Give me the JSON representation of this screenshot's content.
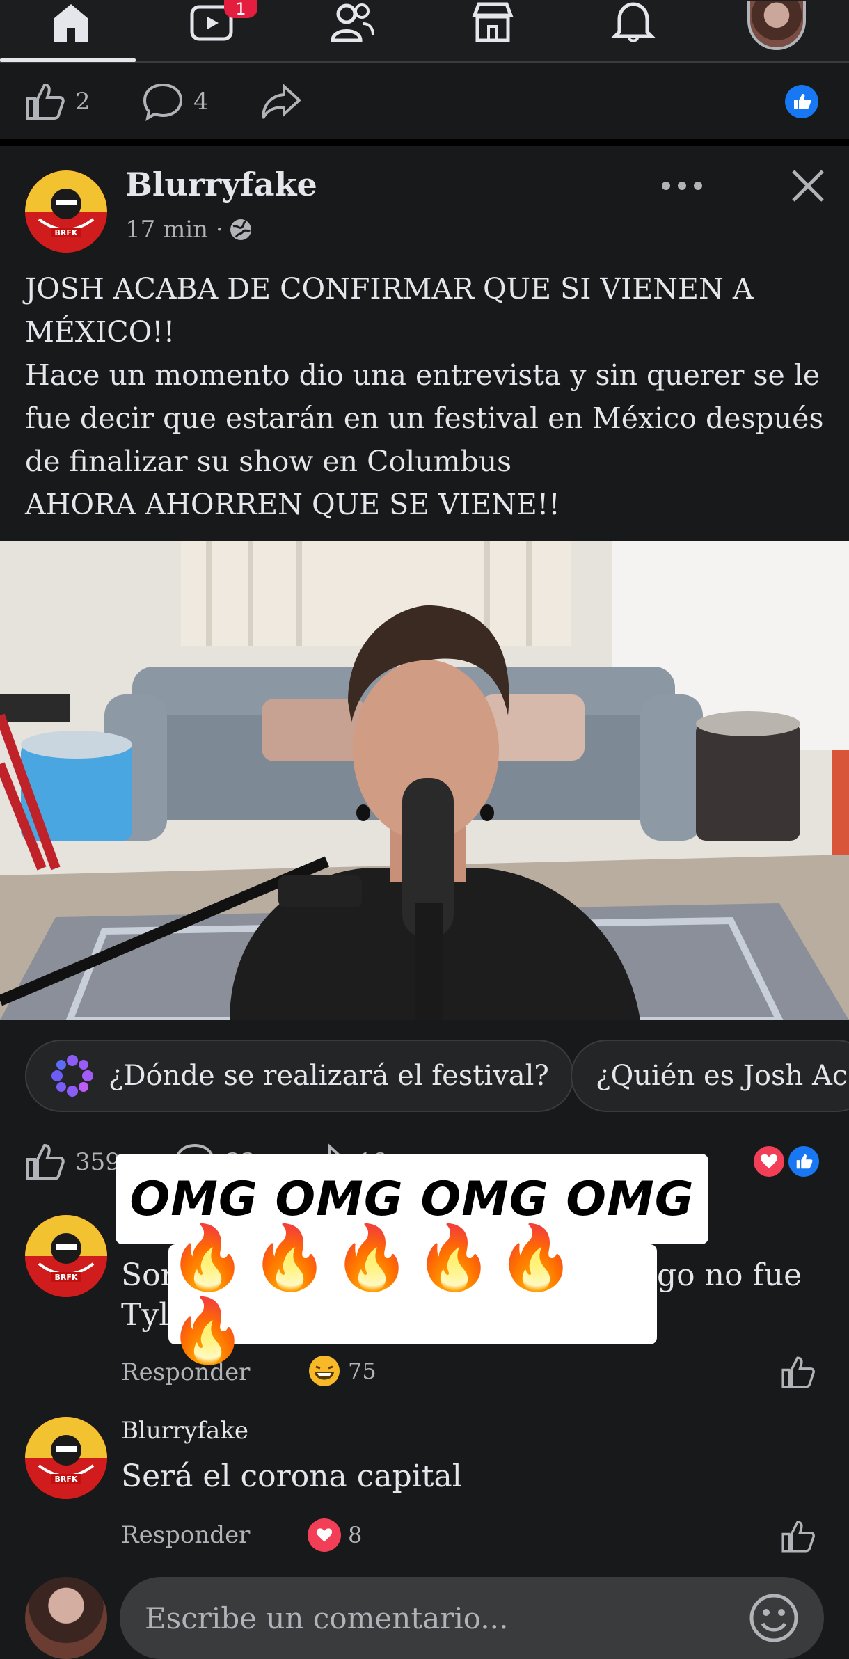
{
  "nav": {
    "items": [
      {
        "name": "home",
        "icon": "home-icon",
        "active": true
      },
      {
        "name": "video",
        "icon": "video-icon",
        "badge": "1"
      },
      {
        "name": "friends",
        "icon": "friends-icon"
      },
      {
        "name": "marketplace",
        "icon": "marketplace-icon"
      },
      {
        "name": "notifications",
        "icon": "bell-icon"
      },
      {
        "name": "profile",
        "icon": "profile-avatar"
      }
    ]
  },
  "prev_post": {
    "likes": "2",
    "comments": "4"
  },
  "post": {
    "author": "Blurryfake",
    "time": "17 min ·",
    "text": [
      "JOSH ACABA DE CONFIRMAR QUE SI VIENEN A MÉXICO!!",
      "Hace un momento dio una entrevista y sin querer se le fue decir que estarán en un festival en México después de finalizar su show en Columbus",
      "AHORA AHORREN QUE SE VIENE!!"
    ],
    "likes": "359",
    "comments": "33",
    "shares": "18"
  },
  "chips": [
    {
      "label": "¿Dónde se realizará el festival?"
    },
    {
      "label": "¿Quién es Josh Ac"
    }
  ],
  "overlay": {
    "line1": "OMG OMG OMG OMG",
    "line2": "🔥🔥🔥🔥🔥🔥"
  },
  "comments": [
    {
      "text_left": "Son",
      "text_right": "go no fue",
      "text_line2": "Tyl",
      "reply": "Responder",
      "reaction_count": "75"
    },
    {
      "author": "Blurryfake",
      "text": "Será el corona capital",
      "reply": "Responder",
      "reaction_count": "8"
    }
  ],
  "comment_input": {
    "placeholder": "Escribe un comentario..."
  },
  "colors": {
    "background": "#18191a",
    "like_blue": "#1877f2",
    "love_red": "#f33e58",
    "badge_red": "#e41e3f"
  }
}
